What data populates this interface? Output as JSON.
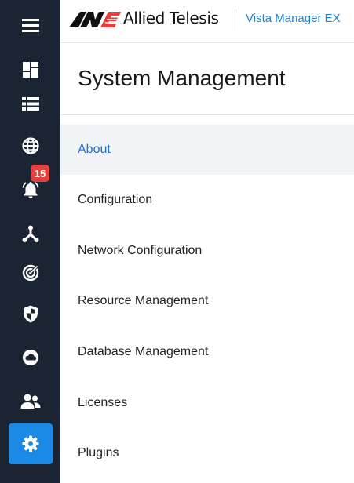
{
  "header": {
    "brand": "Allied Telesis",
    "product": "Vista Manager EX"
  },
  "page": {
    "title": "System Management"
  },
  "notifications": {
    "count": "15"
  },
  "rail": {
    "icons": [
      "menu-icon",
      "dashboard-icon",
      "list-icon",
      "globe-icon",
      "bell-icon",
      "topology-icon",
      "wireless-icon",
      "shield-icon",
      "cloud-icon",
      "users-icon",
      "gear-icon"
    ],
    "active": "gear-icon"
  },
  "menu": {
    "items": [
      {
        "label": "About",
        "active": true
      },
      {
        "label": "Configuration"
      },
      {
        "label": "Network Configuration"
      },
      {
        "label": "Resource Management"
      },
      {
        "label": "Database Management"
      },
      {
        "label": "Licenses"
      },
      {
        "label": "Plugins"
      }
    ]
  },
  "colors": {
    "rail_bg": "#1b2433",
    "accent": "#1a8ae6",
    "link": "#1e6fd9",
    "badge": "#e5413c"
  }
}
